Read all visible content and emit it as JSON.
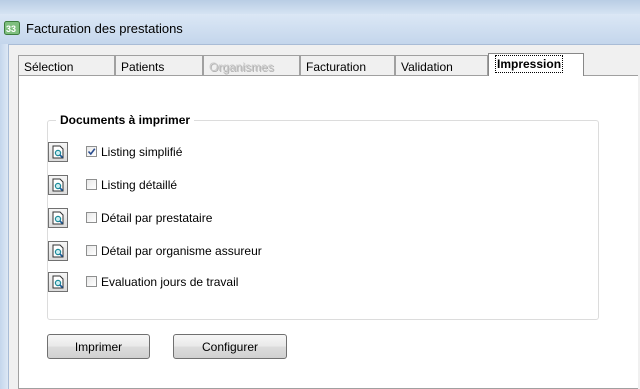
{
  "window": {
    "title": "Facturation des prestations"
  },
  "tabs": [
    {
      "label": "Sélection"
    },
    {
      "label": "Patients"
    },
    {
      "label": "Organismes"
    },
    {
      "label": "Facturation"
    },
    {
      "label": "Validation"
    },
    {
      "label": "Impression"
    }
  ],
  "active_tab": "Impression",
  "documents": {
    "title": "Documents à imprimer",
    "items": [
      {
        "label": "Listing simplifié",
        "checked": true
      },
      {
        "label": "Listing détaillé",
        "checked": false
      },
      {
        "label": "Détail par prestataire",
        "checked": false
      },
      {
        "label": "Détail par organisme assureur",
        "checked": false
      },
      {
        "label": "Evaluation jours de travail",
        "checked": false
      }
    ]
  },
  "buttons": {
    "print": "Imprimer",
    "configure": "Configurer"
  },
  "icons": {
    "app": "app-icon",
    "preview": "print-preview-icon",
    "check": "checkmark-icon"
  },
  "colors": {
    "titlebar": "#c4d6ec",
    "check": "#2a4d8f",
    "preview_glass": "#20a0b0"
  }
}
